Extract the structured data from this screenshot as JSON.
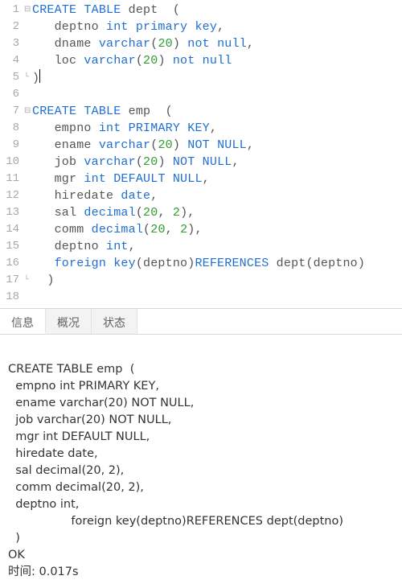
{
  "editor": {
    "lines": [
      {
        "n": 1,
        "fold": "⊟",
        "tokens": [
          [
            "kw",
            "CREATE TABLE"
          ],
          [
            "txt",
            " dept  ("
          ]
        ]
      },
      {
        "n": 2,
        "fold": "",
        "tokens": [
          [
            "txt",
            "   deptno "
          ],
          [
            "type",
            "int"
          ],
          [
            "txt",
            " "
          ],
          [
            "kw",
            "primary key"
          ],
          [
            "txt",
            ","
          ]
        ]
      },
      {
        "n": 3,
        "fold": "",
        "tokens": [
          [
            "txt",
            "   dname "
          ],
          [
            "kw",
            "varchar"
          ],
          [
            "txt",
            "("
          ],
          [
            "num",
            "20"
          ],
          [
            "txt",
            ") "
          ],
          [
            "kw",
            "not null"
          ],
          [
            "txt",
            ","
          ]
        ]
      },
      {
        "n": 4,
        "fold": "",
        "tokens": [
          [
            "txt",
            "   loc "
          ],
          [
            "kw",
            "varchar"
          ],
          [
            "txt",
            "("
          ],
          [
            "num",
            "20"
          ],
          [
            "txt",
            ") "
          ],
          [
            "kw",
            "not null"
          ]
        ]
      },
      {
        "n": 5,
        "fold": "└",
        "tokens": [
          [
            "txt",
            ")"
          ]
        ],
        "caret": true
      },
      {
        "n": 6,
        "fold": "",
        "tokens": [
          [
            "txt",
            ""
          ]
        ]
      },
      {
        "n": 7,
        "fold": "⊟",
        "tokens": [
          [
            "kw",
            "CREATE TABLE"
          ],
          [
            "txt",
            " emp  ("
          ]
        ]
      },
      {
        "n": 8,
        "fold": "",
        "tokens": [
          [
            "txt",
            "   empno "
          ],
          [
            "type",
            "int"
          ],
          [
            "txt",
            " "
          ],
          [
            "kw",
            "PRIMARY KEY"
          ],
          [
            "txt",
            ","
          ]
        ]
      },
      {
        "n": 9,
        "fold": "",
        "tokens": [
          [
            "txt",
            "   ename "
          ],
          [
            "kw",
            "varchar"
          ],
          [
            "txt",
            "("
          ],
          [
            "num",
            "20"
          ],
          [
            "txt",
            ") "
          ],
          [
            "kw",
            "NOT NULL"
          ],
          [
            "txt",
            ","
          ]
        ]
      },
      {
        "n": 10,
        "fold": "",
        "tokens": [
          [
            "txt",
            "   job "
          ],
          [
            "kw",
            "varchar"
          ],
          [
            "txt",
            "("
          ],
          [
            "num",
            "20"
          ],
          [
            "txt",
            ") "
          ],
          [
            "kw",
            "NOT NULL"
          ],
          [
            "txt",
            ","
          ]
        ]
      },
      {
        "n": 11,
        "fold": "",
        "tokens": [
          [
            "txt",
            "   mgr "
          ],
          [
            "type",
            "int"
          ],
          [
            "txt",
            " "
          ],
          [
            "kw",
            "DEFAULT NULL"
          ],
          [
            "txt",
            ","
          ]
        ]
      },
      {
        "n": 12,
        "fold": "",
        "tokens": [
          [
            "txt",
            "   hiredate "
          ],
          [
            "type",
            "date"
          ],
          [
            "txt",
            ","
          ]
        ]
      },
      {
        "n": 13,
        "fold": "",
        "tokens": [
          [
            "txt",
            "   sal "
          ],
          [
            "kw",
            "decimal"
          ],
          [
            "txt",
            "("
          ],
          [
            "num",
            "20"
          ],
          [
            "txt",
            ", "
          ],
          [
            "num",
            "2"
          ],
          [
            "txt",
            "),"
          ]
        ]
      },
      {
        "n": 14,
        "fold": "",
        "tokens": [
          [
            "txt",
            "   comm "
          ],
          [
            "kw",
            "decimal"
          ],
          [
            "txt",
            "("
          ],
          [
            "num",
            "20"
          ],
          [
            "txt",
            ", "
          ],
          [
            "num",
            "2"
          ],
          [
            "txt",
            "),"
          ]
        ]
      },
      {
        "n": 15,
        "fold": "",
        "tokens": [
          [
            "txt",
            "   deptno "
          ],
          [
            "type",
            "int"
          ],
          [
            "txt",
            ","
          ]
        ]
      },
      {
        "n": 16,
        "fold": "",
        "tokens": [
          [
            "txt",
            "   "
          ],
          [
            "kw",
            "foreign key"
          ],
          [
            "txt",
            "(deptno)"
          ],
          [
            "kw",
            "REFERENCES"
          ],
          [
            "txt",
            " dept(deptno)"
          ]
        ]
      },
      {
        "n": 17,
        "fold": "└",
        "tokens": [
          [
            "txt",
            "  )"
          ]
        ]
      },
      {
        "n": 18,
        "fold": "",
        "tokens": [
          [
            "txt",
            ""
          ]
        ]
      }
    ]
  },
  "tabs": {
    "info": "信息",
    "profile": "概况",
    "status": "状态"
  },
  "output": {
    "l1": "CREATE TABLE emp  (",
    "l2": "  empno int PRIMARY KEY,",
    "l3": "  ename varchar(20) NOT NULL,",
    "l4": "  job varchar(20) NOT NULL,",
    "l5": "  mgr int DEFAULT NULL,",
    "l6": "  hiredate date,",
    "l7": "  sal decimal(20, 2),",
    "l8": "  comm decimal(20, 2),",
    "l9": "  deptno int,",
    "l10": "                 foreign key(deptno)REFERENCES dept(deptno)",
    "l11": "  )",
    "l12": "OK",
    "l13": "时间: 0.017s"
  }
}
